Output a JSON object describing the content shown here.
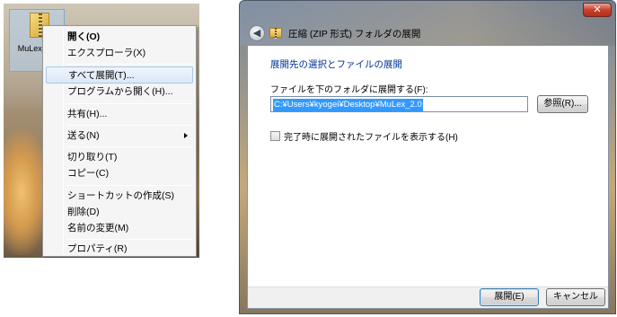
{
  "left": {
    "file": {
      "label": "MuLex_2.0"
    },
    "menu": {
      "open": "開く(O)",
      "explorer": "エクスプローラ(X)",
      "extract_all": "すべて展開(T)...",
      "open_with": "プログラムから開く(H)...",
      "share": "共有(H)...",
      "send_to": "送る(N)",
      "cut": "切り取り(T)",
      "copy": "コピー(C)",
      "create_shortcut": "ショートカットの作成(S)",
      "delete": "削除(D)",
      "rename": "名前の変更(M)",
      "properties": "プロパティ(R)"
    }
  },
  "dialog": {
    "title": "圧縮 (ZIP 形式) フォルダの展開",
    "close_glyph": "✕",
    "back_glyph": "◀",
    "heading": "展開先の選択とファイルの展開",
    "dest_label": "ファイルを下のフォルダに展開する(F):",
    "dest_value": "C:¥Users¥kyogei¥Desktop¥MuLex_2.0",
    "browse_button": "参照(R)...",
    "show_files_label": "完了時に展開されたファイルを表示する(H)",
    "show_files_checked": false,
    "extract_button": "展開(E)",
    "cancel_button": "キャンセル"
  }
}
